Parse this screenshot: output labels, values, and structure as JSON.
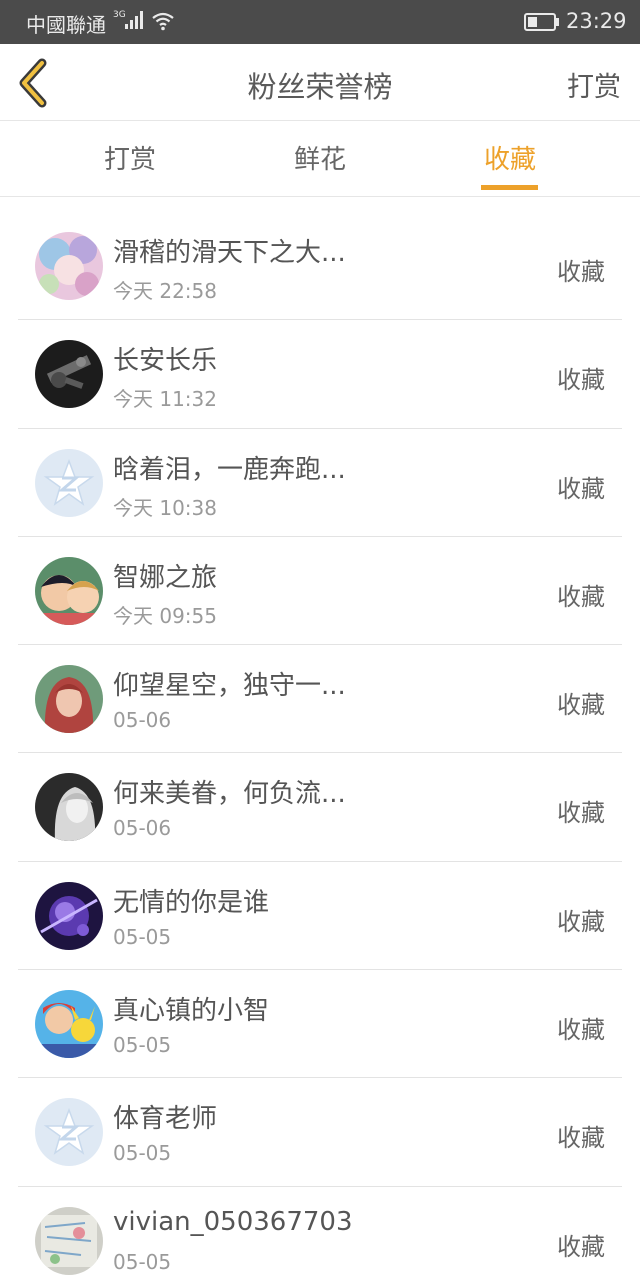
{
  "status_bar": {
    "carrier": "中國聯通",
    "network": "3G",
    "time": "23:29"
  },
  "nav": {
    "title": "粉丝荣誉榜",
    "action_label": "打赏",
    "icons": {
      "back": "chevron-left-icon"
    }
  },
  "tabs": [
    {
      "label": "打赏"
    },
    {
      "label": "鲜花"
    },
    {
      "label": "收藏",
      "active": true
    }
  ],
  "colors": {
    "accent": "#eda12a",
    "status_bar": "#4b4b4b"
  },
  "fans": [
    {
      "name": "滑稽的滑天下之大...",
      "time": "今天 22:58",
      "action": "收藏",
      "avatar": "anime-girl-avatar"
    },
    {
      "name": "长安长乐",
      "time": "今天 11:32",
      "action": "收藏",
      "avatar": "dark-photo-avatar"
    },
    {
      "name": "晗着泪，一鹿奔跑...",
      "time": "今天 10:38",
      "action": "收藏",
      "avatar": "default-star-avatar"
    },
    {
      "name": "智娜之旅",
      "time": "今天 09:55",
      "action": "收藏",
      "avatar": "anime-couple-avatar"
    },
    {
      "name": "仰望星空，独守一...",
      "time": "05-06",
      "action": "收藏",
      "avatar": "red-hair-girl-avatar"
    },
    {
      "name": "何来美眷，何负流...",
      "time": "05-06",
      "action": "收藏",
      "avatar": "grayscale-portrait-avatar"
    },
    {
      "name": "无情的你是谁",
      "time": "05-05",
      "action": "收藏",
      "avatar": "purple-galaxy-avatar"
    },
    {
      "name": "真心镇的小智",
      "time": "05-05",
      "action": "收藏",
      "avatar": "pokemon-avatar"
    },
    {
      "name": "体育老师",
      "time": "05-05",
      "action": "收藏",
      "avatar": "default-star-avatar"
    },
    {
      "name": "vivian_050367703",
      "time": "05-05",
      "action": "收藏",
      "avatar": "sketch-avatar"
    }
  ]
}
